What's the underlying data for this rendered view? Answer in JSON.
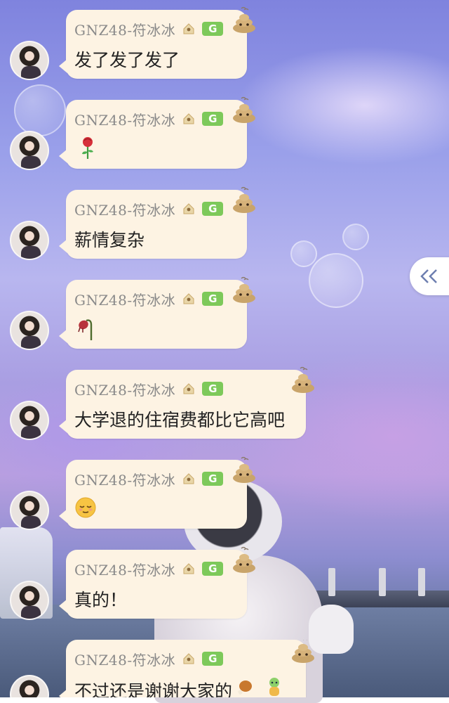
{
  "sender": {
    "name": "GNZ48-符冰冰",
    "badge": "G",
    "home_icon": "house-icon",
    "reaction_icon": "poop-icon"
  },
  "messages": [
    {
      "text": "发了发了发了",
      "icon": ""
    },
    {
      "text": "",
      "icon": "rose-emoji-icon"
    },
    {
      "text": "薪情复杂",
      "icon": ""
    },
    {
      "text": "",
      "icon": "wilted-rose-emoji-icon"
    },
    {
      "text": "大学退的住宿费都比它高吧",
      "icon": ""
    },
    {
      "text": "",
      "icon": "sleepy-face-emoji-icon"
    },
    {
      "text": "真的！",
      "icon": ""
    },
    {
      "text": "不过还是谢谢大家的",
      "icon": "chicken-leg-and-figure-emoji-icon"
    }
  ],
  "side_panel": {
    "collapse_icon": "double-chevron-left-icon"
  },
  "colors": {
    "bubble": "#fdf3e3",
    "badge": "#7dc95a",
    "name": "#8a8a8a"
  }
}
